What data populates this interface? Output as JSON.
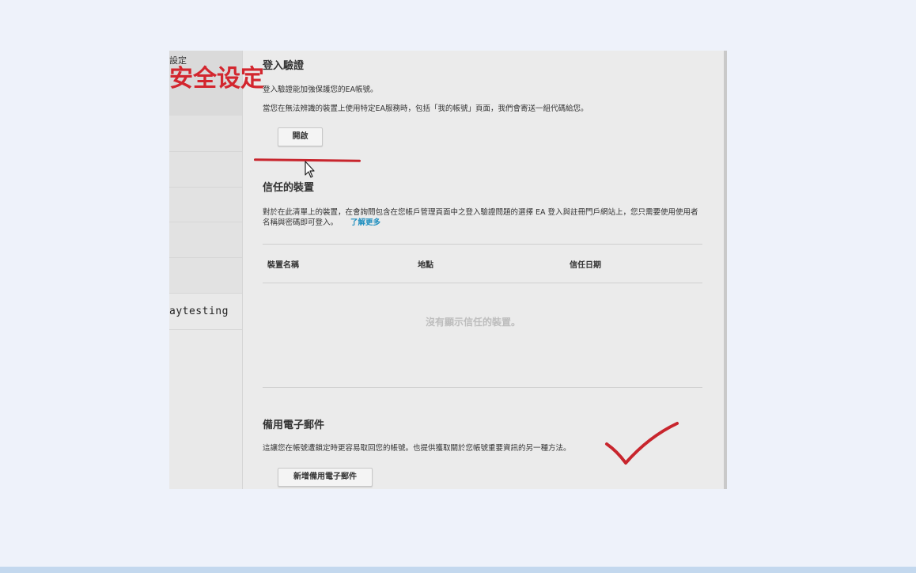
{
  "overlay": {
    "title": "安全设定",
    "small_label": "設定"
  },
  "sidebar": {
    "items": [
      "",
      "",
      "",
      "",
      "",
      "",
      "",
      "aytesting"
    ]
  },
  "login_verification": {
    "heading": "登入驗證",
    "desc1": "登入驗證能加強保護您的EA帳號。",
    "desc2": "當您在無法辨識的裝置上使用特定EA服務時，包括「我的帳號」頁面，我們會寄送一組代碼給您。",
    "button": "開啟"
  },
  "trusted_devices": {
    "heading": "信任的裝置",
    "desc": "對於在此清單上的裝置，在會詢問包含在您帳戶管理頁面中之登入驗證問題的選擇 EA 登入與註冊門戶網站上，您只需要使用使用者名稱與密碼即可登入。",
    "learn_more": "了解更多",
    "columns": [
      "裝置名稱",
      "地點",
      "信任日期"
    ],
    "empty_text": "沒有顯示信任的裝置。"
  },
  "backup_email": {
    "heading": "備用電子郵件",
    "desc": "這讓您在帳號遭鎖定時更容易取回您的帳號。也提供獲取關於您帳號重要資訊的另一種方法。",
    "button": "新增備用電子郵件"
  },
  "colors": {
    "annotation_red": "#c8252d",
    "link": "#1f8fbf"
  }
}
